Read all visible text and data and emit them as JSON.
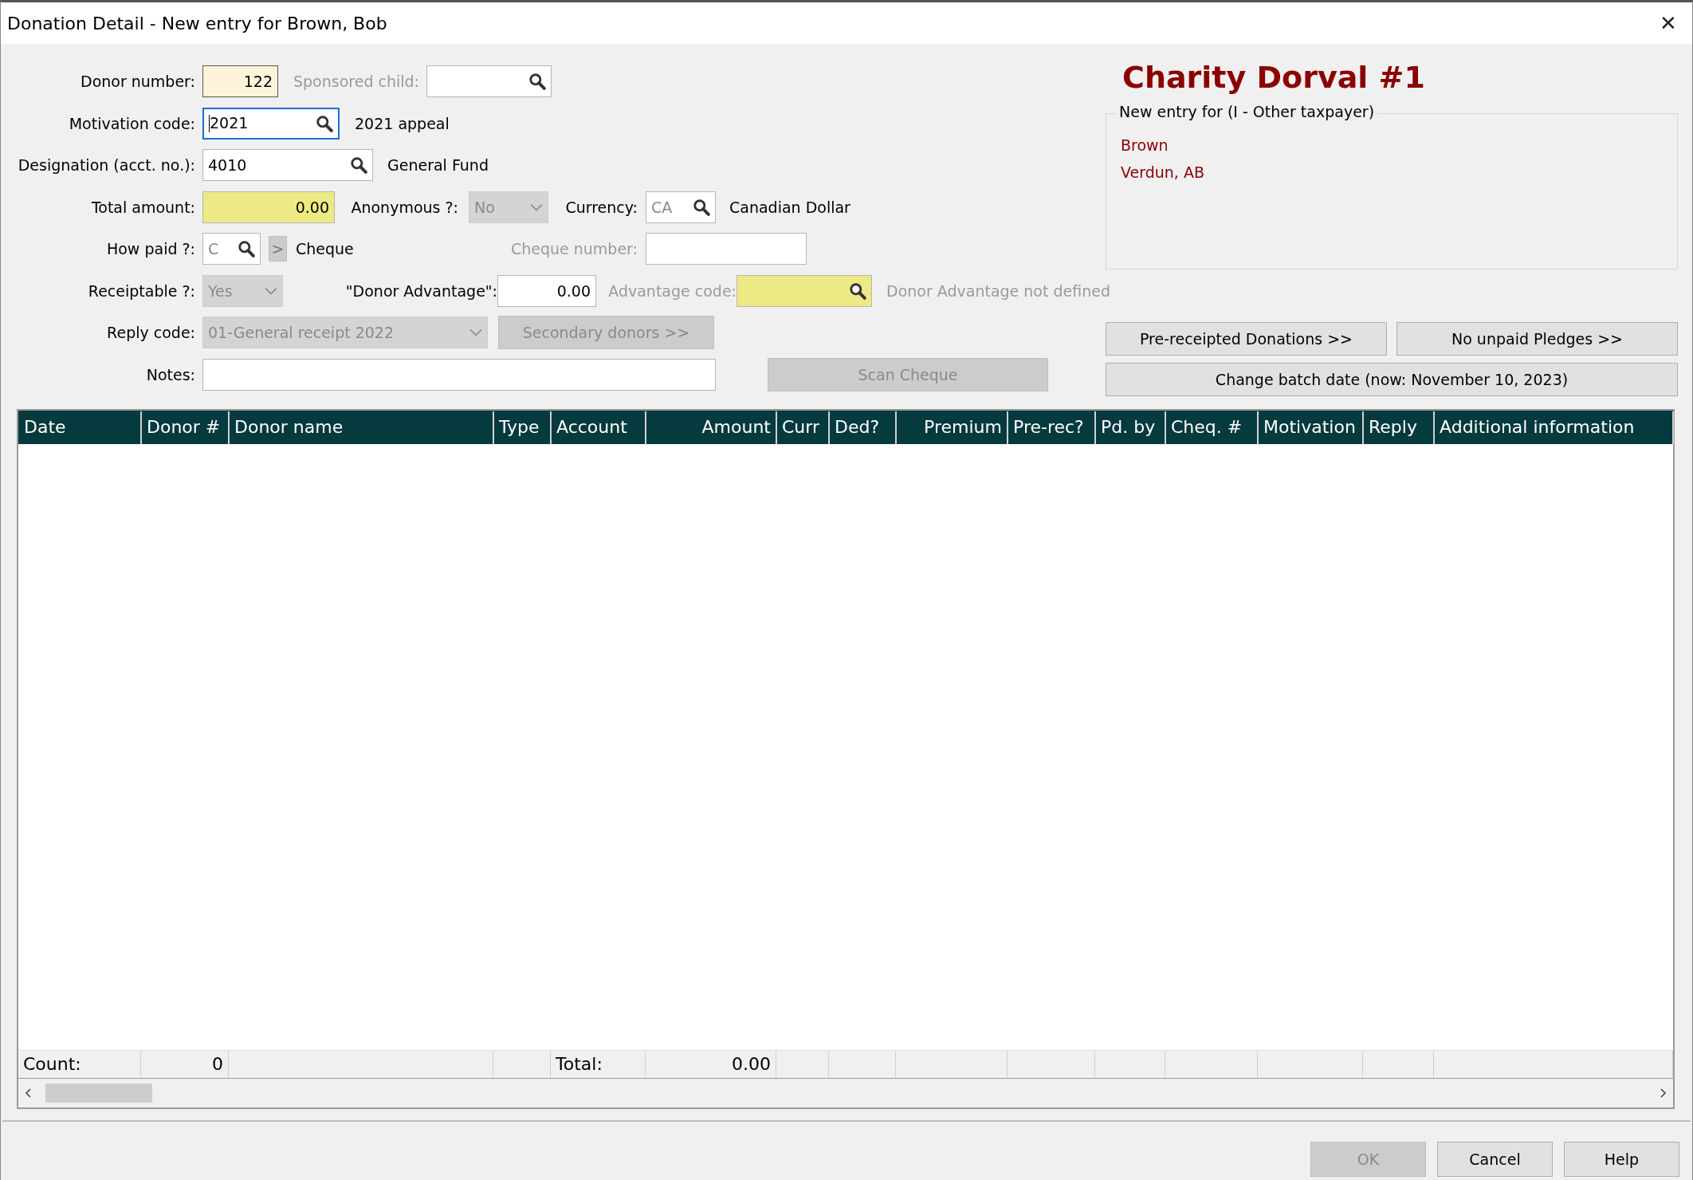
{
  "window": {
    "title": "Donation Detail - New entry for Brown, Bob",
    "close": "✕"
  },
  "form": {
    "donor_number": {
      "label": "Donor number:",
      "value": "122",
      "read_only": true,
      "disabled": false
    },
    "sponsored_child": {
      "label": "Sponsored child:",
      "disabled": true
    },
    "motivation_code": {
      "label": "Motivation code:",
      "value": "2021",
      "focused": true,
      "description": "2021 appeal"
    },
    "designation": {
      "label": "Designation (acct. no.):",
      "value": "4010",
      "description": "General Fund"
    },
    "total_amount": {
      "label": "Total amount:",
      "value": "0.00",
      "required": true
    },
    "anonymous": {
      "label": "Anonymous ?:",
      "value": "No",
      "disabled": true
    },
    "currency": {
      "label": "Currency:",
      "value": "CA",
      "disabled": true,
      "description": "Canadian Dollar"
    },
    "how_paid": {
      "label": "How paid ?:",
      "value": "C",
      "disabled": true,
      "button": ">",
      "description": "Cheque"
    },
    "cheque_number": {
      "label": "Cheque number:",
      "disabled": true
    },
    "receiptable": {
      "label": "Receiptable ?:",
      "value": "Yes",
      "disabled": true
    },
    "donor_advantage": {
      "label": "\"Donor Advantage\":",
      "value": "0.00"
    },
    "advantage_code": {
      "label": "Advantage code:",
      "disabled": true,
      "required": true,
      "description": "Donor Advantage not defined"
    },
    "reply_code": {
      "label": "Reply code:",
      "value": "01-General receipt 2022",
      "disabled": true
    },
    "notes": {
      "label": "Notes:"
    },
    "secondary_donors": {
      "label": "Secondary donors  >>",
      "disabled": true
    },
    "scan_cheque": {
      "label": "Scan Cheque",
      "disabled": true
    }
  },
  "organization": {
    "name": "Charity Dorval #1",
    "group_title": "New entry for (I - Other taxpayer)",
    "lines": [
      "Brown",
      "Verdun, AB"
    ]
  },
  "side_buttons": [
    {
      "label": "Pre-receipted Donations  >>",
      "disabled": false
    },
    {
      "label": "No unpaid Pledges >>",
      "disabled": false
    },
    {
      "label": "Change batch date (now: November 10, 2023)",
      "disabled": false
    }
  ],
  "table": {
    "columns": [
      {
        "label": "Date"
      },
      {
        "label": "Donor #"
      },
      {
        "label": "Donor name"
      },
      {
        "label": "Type"
      },
      {
        "label": "Account"
      },
      {
        "label": "Amount"
      },
      {
        "label": "Curr"
      },
      {
        "label": "Ded?"
      },
      {
        "label": "Premium"
      },
      {
        "label": "Pre-rec?"
      },
      {
        "label": "Pd. by"
      },
      {
        "label": "Cheq. #"
      },
      {
        "label": "Motivation"
      },
      {
        "label": "Reply"
      },
      {
        "label": "Additional information"
      }
    ],
    "footer": {
      "count_label": "Count:",
      "count": "0",
      "total_label": "Total:",
      "total": "0.00"
    }
  },
  "dialog_buttons": [
    {
      "label": "OK",
      "disabled": true
    },
    {
      "label": "Cancel",
      "disabled": false
    },
    {
      "label": "Help",
      "disabled": false
    }
  ]
}
